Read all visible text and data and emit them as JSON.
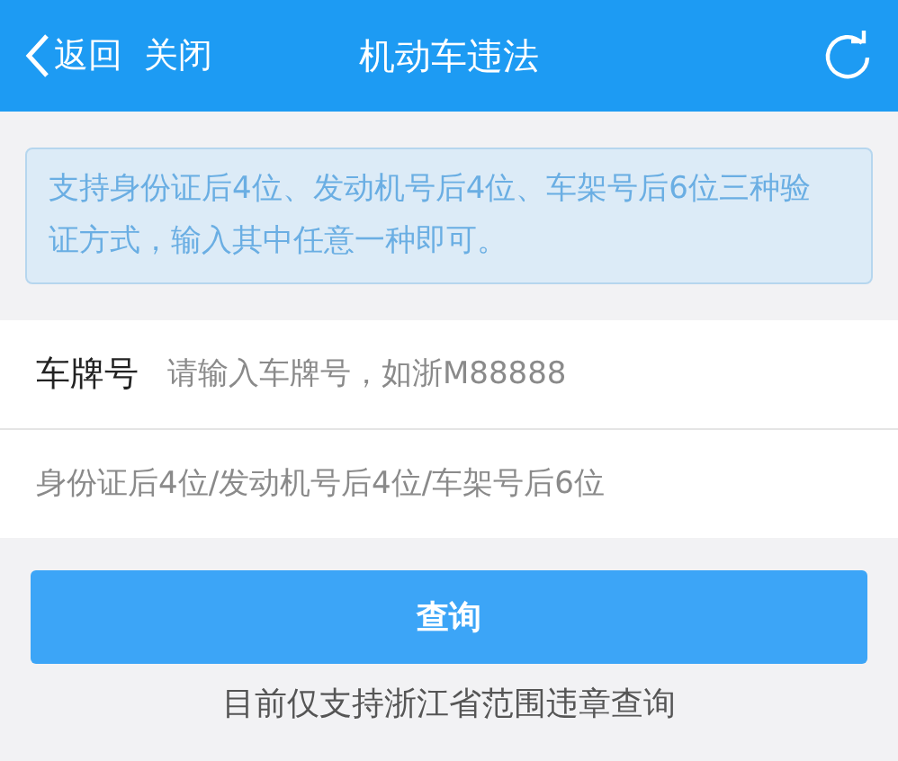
{
  "header": {
    "back": "返回",
    "close": "关闭",
    "title": "机动车违法"
  },
  "notice": "支持身份证后4位、发动机号后4位、车架号后6位三种验证方式，输入其中任意一种即可。",
  "form": {
    "plate_label": "车牌号",
    "plate_placeholder": "请输入车牌号，如浙M88888",
    "id_placeholder": "身份证后4位/发动机号后4位/车架号后6位"
  },
  "button": "查询",
  "footer": "目前仅支持浙江省范围违章查询"
}
